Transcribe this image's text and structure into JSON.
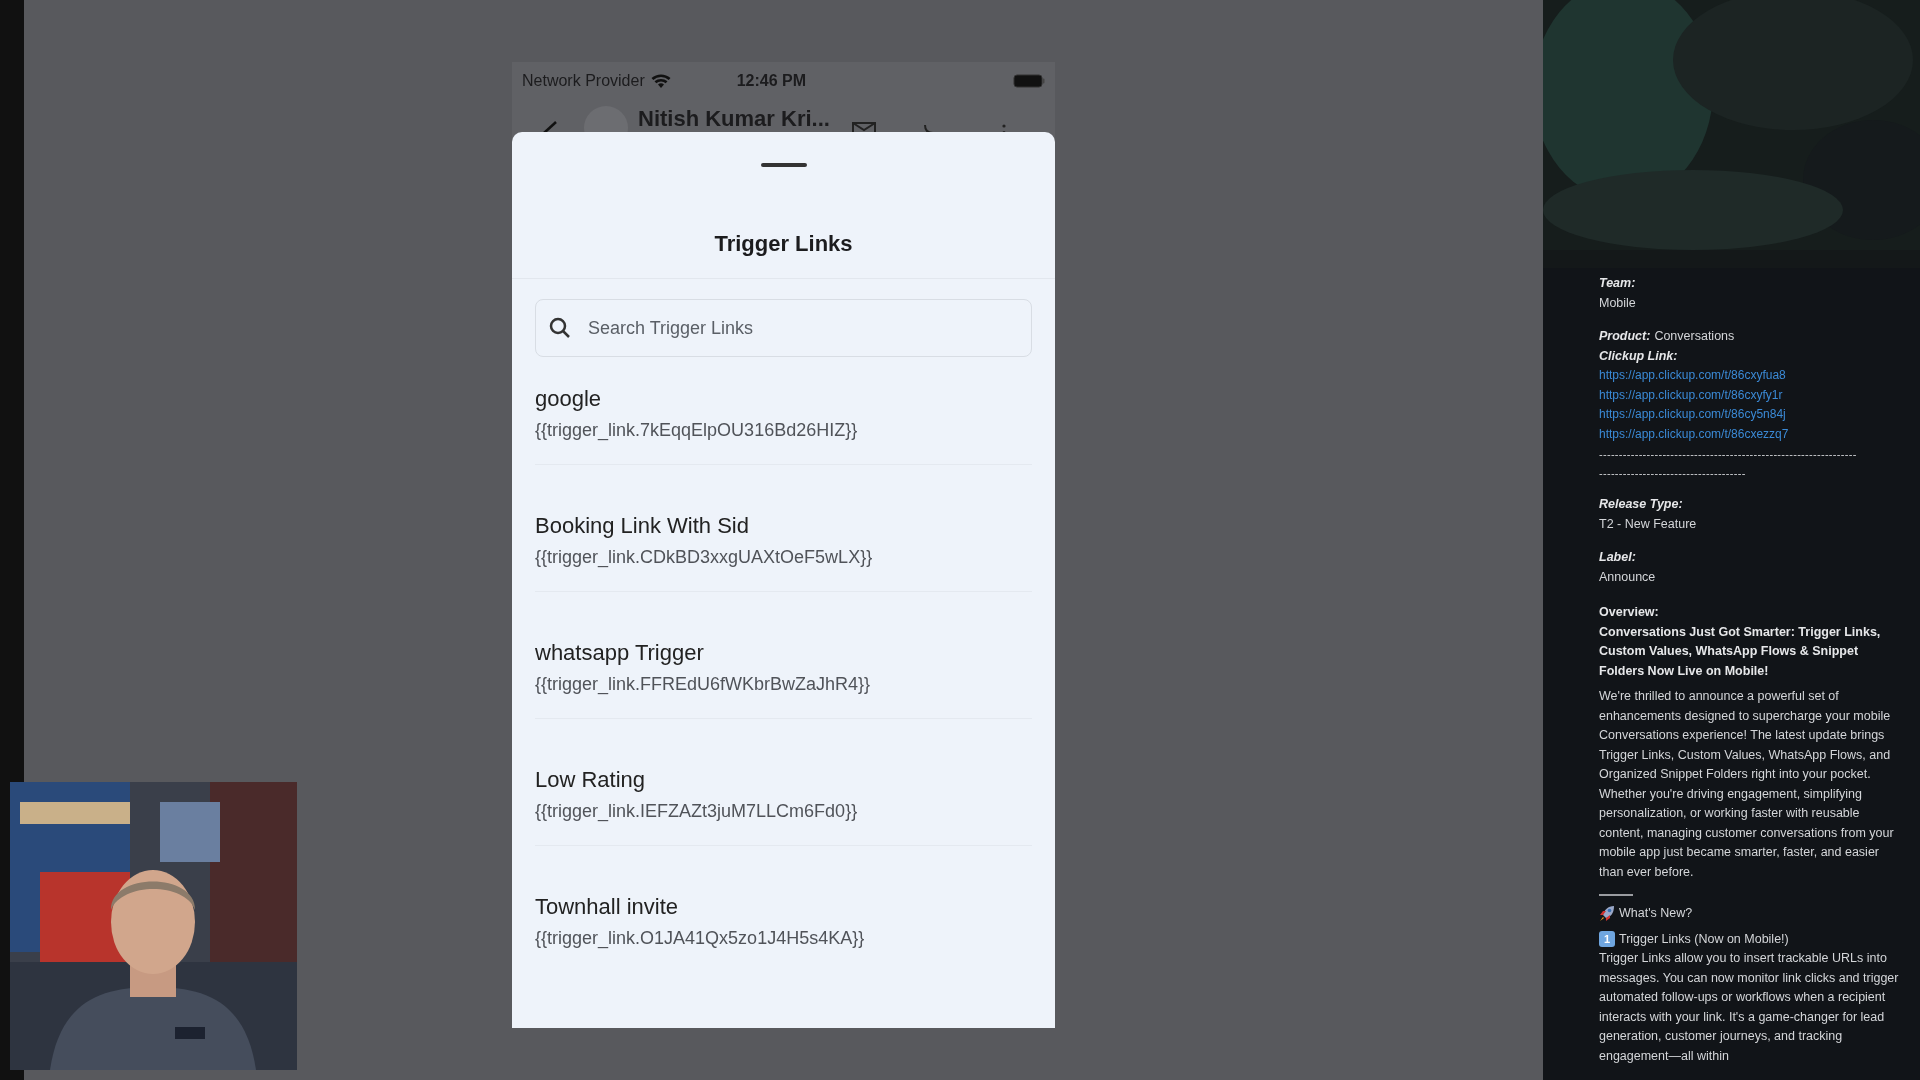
{
  "phone": {
    "status_bar": {
      "carrier": "Network Provider",
      "time": "12:46 PM"
    },
    "header": {
      "name": "Nitish Kumar Kri..."
    },
    "sheet": {
      "title": "Trigger Links",
      "search": {
        "placeholder": "Search Trigger Links"
      },
      "links": [
        {
          "name": "google",
          "code": "{{trigger_link.7kEqqElpOU316Bd26HIZ}}"
        },
        {
          "name": "Booking Link With Sid",
          "code": "{{trigger_link.CDkBD3xxgUAXtOeF5wLX}}"
        },
        {
          "name": "whatsapp Trigger",
          "code": "{{trigger_link.FFREdU6fWKbrBwZaJhR4}}"
        },
        {
          "name": "Low Rating",
          "code": "{{trigger_link.IEFZAZt3juM7LLCm6Fd0}}"
        },
        {
          "name": "Townhall invite",
          "code": "{{trigger_link.O1JA41Qx5zo1J4H5s4KA}}"
        }
      ]
    }
  },
  "notes": [
    {
      "kind": "stacked",
      "label": "Team:",
      "value": "Mobile"
    },
    {
      "kind": "inline",
      "label": "Product:",
      "value": "Conversations"
    },
    {
      "kind": "links",
      "label": "Clickup Link:",
      "links": [
        "https://app.clickup.com/t/86cxyfua8",
        "https://app.clickup.com/t/86cxyfy1r",
        "https://app.clickup.com/t/86cy5n84j",
        "https://app.clickup.com/t/86cxezzq7"
      ]
    },
    {
      "kind": "dashes",
      "lines": [
        "-----------------------------------------------------------------",
        "-------------------------------------"
      ]
    },
    {
      "kind": "stacked",
      "label": "Release Type:",
      "value": "T2 - New Feature"
    },
    {
      "kind": "stacked",
      "label": "Label:",
      "value": "Announce"
    },
    {
      "kind": "overview",
      "label": "Overview:",
      "headline": "Conversations Just Got Smarter: Trigger Links, Custom Values, WhatsApp Flows & Snippet Folders Now Live on Mobile!",
      "body": "We're thrilled to announce a powerful set of enhancements designed to supercharge your mobile Conversations experience! The latest update brings Trigger Links, Custom Values, WhatsApp Flows, and Organized Snippet Folders right into your pocket. Whether you're driving engagement, simplifying personalization, or working faster with reusable content, managing customer conversations from your mobile app just became smarter, faster, and easier than ever before."
    },
    {
      "kind": "divider"
    },
    {
      "kind": "rocket_heading",
      "text": "What's New?"
    },
    {
      "kind": "numbered",
      "number": "1",
      "text": "Trigger Links (Now on Mobile!)",
      "body": "Trigger Links allow you to insert trackable URLs into messages. You can now monitor link clicks and trigger automated follow-ups or workflows when a recipient interacts with your link. It's a game-changer for lead generation, customer journeys, and tracking engagement—all within"
    }
  ]
}
